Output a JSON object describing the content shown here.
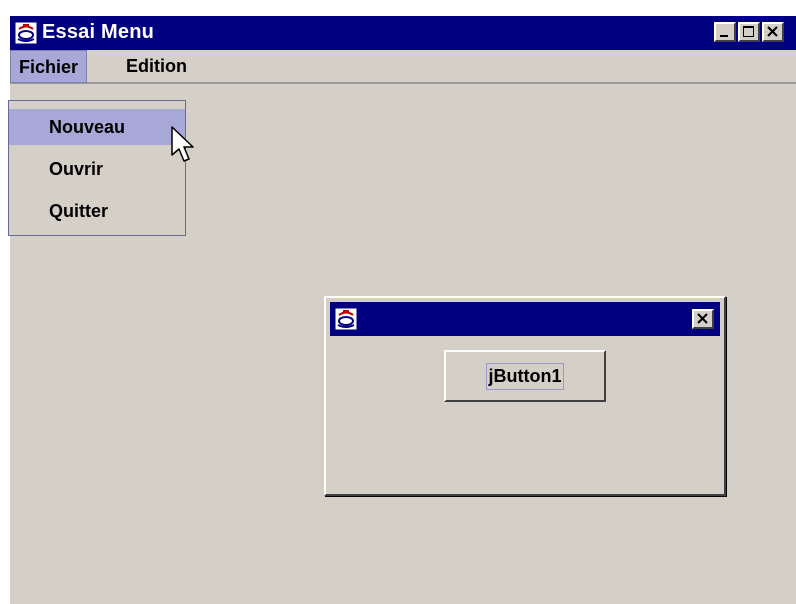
{
  "window": {
    "title": "Essai Menu",
    "icon": "java-app-icon",
    "controls": {
      "minimize": "minimize-icon",
      "maximize": "maximize-icon",
      "close": "close-icon"
    }
  },
  "menubar": {
    "items": [
      {
        "label": "Fichier",
        "active": true
      },
      {
        "label": "Edition",
        "active": false
      }
    ]
  },
  "dropdown": {
    "items": [
      {
        "label": "Nouveau",
        "selected": true
      },
      {
        "label": "Ouvrir",
        "selected": false
      },
      {
        "label": "Quitter",
        "selected": false
      }
    ]
  },
  "dialog": {
    "title": "",
    "icon": "java-app-icon",
    "button_label": "jButton1"
  },
  "colors": {
    "titlebar": "#000080",
    "face": "#d4d0c8",
    "highlight": "#a8a8d8"
  }
}
